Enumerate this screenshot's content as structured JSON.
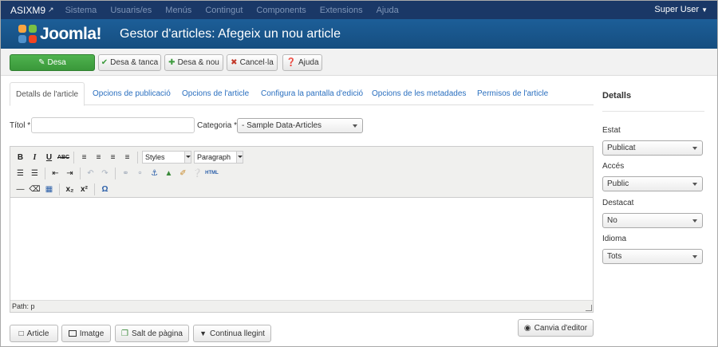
{
  "navbar": {
    "brand": "ASIXM9",
    "brand_ext_icon": "external-link-icon",
    "menu": [
      "Sistema",
      "Usuaris/es",
      "Menús",
      "Contingut",
      "Components",
      "Extensions",
      "Ajuda"
    ],
    "user": "Super User"
  },
  "header": {
    "logo_text": "Joomla!",
    "title": "Gestor d'articles: Afegeix un nou article"
  },
  "toolbar": {
    "save": "Desa",
    "save_close": "Desa & tanca",
    "save_new": "Desa & nou",
    "cancel": "Cancel·la",
    "help": "Ajuda"
  },
  "tabs": [
    "Detalls de l'article",
    "Opcions de publicació",
    "Opcions de l'article",
    "Configura la pantalla d'edició",
    "Opcions de les metadades",
    "Permisos de l'article"
  ],
  "form": {
    "title_label": "Títol *",
    "title_value": "",
    "category_label": "Categoria *",
    "category_value": "- Sample Data-Articles"
  },
  "editor": {
    "styles": "Styles",
    "format": "Paragraph",
    "path": "Path: p"
  },
  "bottom_buttons": {
    "article": "Article",
    "image": "Imatge",
    "pagebreak": "Salt de pàgina",
    "readmore": "Continua llegint",
    "toggle_editor": "Canvia d'editor"
  },
  "sidebar": {
    "title": "Detalls",
    "fields": [
      {
        "label": "Estat",
        "value": "Publicat"
      },
      {
        "label": "Accés",
        "value": "Public"
      },
      {
        "label": "Destacat",
        "value": "No"
      },
      {
        "label": "Idioma",
        "value": "Tots"
      }
    ]
  },
  "colors": {
    "navbar": "#1a3867",
    "header": "#17568c",
    "save_button": "#46a546",
    "link": "#2a6fbf"
  }
}
